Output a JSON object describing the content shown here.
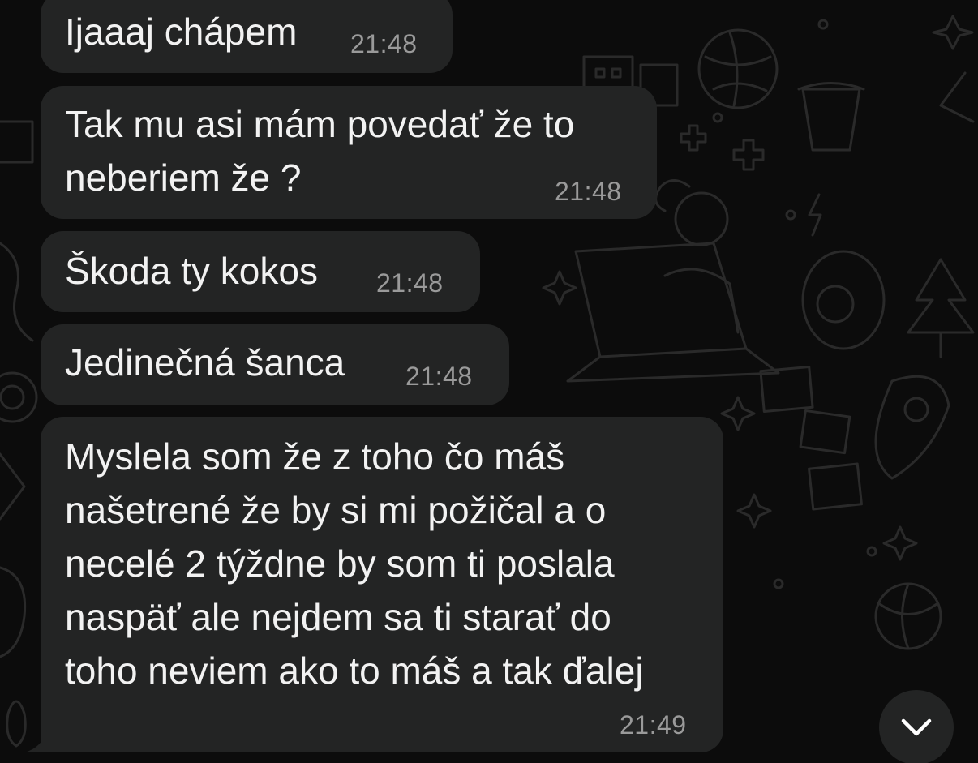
{
  "theme": {
    "bubble_color": "#232424",
    "text_color": "#f2f2f2",
    "time_color": "#9a9a9a",
    "background": "#0c0c0c"
  },
  "messages": [
    {
      "lines": [
        "Ijaaaj chápem"
      ],
      "time": "21:48"
    },
    {
      "lines": [
        "Tak mu asi mám povedať že to",
        "neberiem že ?"
      ],
      "time": "21:48"
    },
    {
      "lines": [
        "Škoda ty kokos"
      ],
      "time": "21:48"
    },
    {
      "lines": [
        "Jedinečná šanca"
      ],
      "time": "21:48"
    },
    {
      "lines": [
        "Myslela som že z toho čo máš",
        "našetrené že by si mi požičal a o",
        "necelé 2 týždne by som ti poslala",
        "naspäť ale nejdem sa ti starať do",
        "toho neviem ako to máš a tak ďalej"
      ],
      "time": "21:49"
    }
  ],
  "scroll_down_icon": "chevron-down-icon"
}
